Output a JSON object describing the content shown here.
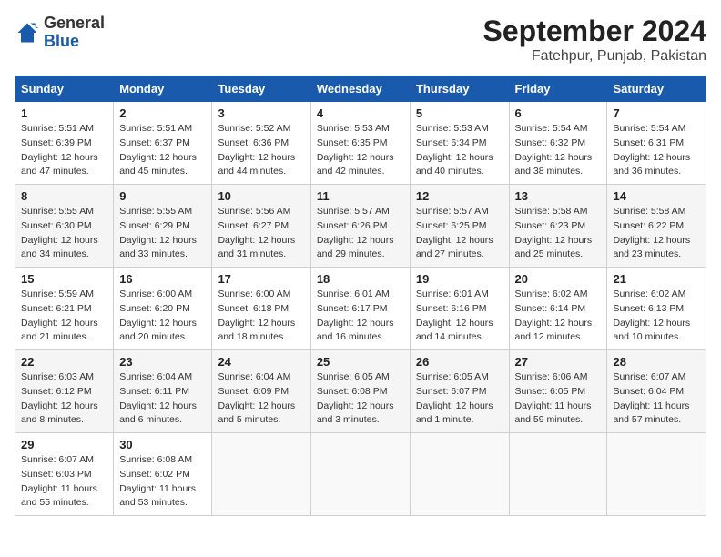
{
  "header": {
    "logo_general": "General",
    "logo_blue": "Blue",
    "month_year": "September 2024",
    "location": "Fatehpur, Punjab, Pakistan"
  },
  "weekdays": [
    "Sunday",
    "Monday",
    "Tuesday",
    "Wednesday",
    "Thursday",
    "Friday",
    "Saturday"
  ],
  "weeks": [
    [
      {
        "day": "1",
        "sunrise": "5:51 AM",
        "sunset": "6:39 PM",
        "daylight": "12 hours and 47 minutes."
      },
      {
        "day": "2",
        "sunrise": "5:51 AM",
        "sunset": "6:37 PM",
        "daylight": "12 hours and 45 minutes."
      },
      {
        "day": "3",
        "sunrise": "5:52 AM",
        "sunset": "6:36 PM",
        "daylight": "12 hours and 44 minutes."
      },
      {
        "day": "4",
        "sunrise": "5:53 AM",
        "sunset": "6:35 PM",
        "daylight": "12 hours and 42 minutes."
      },
      {
        "day": "5",
        "sunrise": "5:53 AM",
        "sunset": "6:34 PM",
        "daylight": "12 hours and 40 minutes."
      },
      {
        "day": "6",
        "sunrise": "5:54 AM",
        "sunset": "6:32 PM",
        "daylight": "12 hours and 38 minutes."
      },
      {
        "day": "7",
        "sunrise": "5:54 AM",
        "sunset": "6:31 PM",
        "daylight": "12 hours and 36 minutes."
      }
    ],
    [
      {
        "day": "8",
        "sunrise": "5:55 AM",
        "sunset": "6:30 PM",
        "daylight": "12 hours and 34 minutes."
      },
      {
        "day": "9",
        "sunrise": "5:55 AM",
        "sunset": "6:29 PM",
        "daylight": "12 hours and 33 minutes."
      },
      {
        "day": "10",
        "sunrise": "5:56 AM",
        "sunset": "6:27 PM",
        "daylight": "12 hours and 31 minutes."
      },
      {
        "day": "11",
        "sunrise": "5:57 AM",
        "sunset": "6:26 PM",
        "daylight": "12 hours and 29 minutes."
      },
      {
        "day": "12",
        "sunrise": "5:57 AM",
        "sunset": "6:25 PM",
        "daylight": "12 hours and 27 minutes."
      },
      {
        "day": "13",
        "sunrise": "5:58 AM",
        "sunset": "6:23 PM",
        "daylight": "12 hours and 25 minutes."
      },
      {
        "day": "14",
        "sunrise": "5:58 AM",
        "sunset": "6:22 PM",
        "daylight": "12 hours and 23 minutes."
      }
    ],
    [
      {
        "day": "15",
        "sunrise": "5:59 AM",
        "sunset": "6:21 PM",
        "daylight": "12 hours and 21 minutes."
      },
      {
        "day": "16",
        "sunrise": "6:00 AM",
        "sunset": "6:20 PM",
        "daylight": "12 hours and 20 minutes."
      },
      {
        "day": "17",
        "sunrise": "6:00 AM",
        "sunset": "6:18 PM",
        "daylight": "12 hours and 18 minutes."
      },
      {
        "day": "18",
        "sunrise": "6:01 AM",
        "sunset": "6:17 PM",
        "daylight": "12 hours and 16 minutes."
      },
      {
        "day": "19",
        "sunrise": "6:01 AM",
        "sunset": "6:16 PM",
        "daylight": "12 hours and 14 minutes."
      },
      {
        "day": "20",
        "sunrise": "6:02 AM",
        "sunset": "6:14 PM",
        "daylight": "12 hours and 12 minutes."
      },
      {
        "day": "21",
        "sunrise": "6:02 AM",
        "sunset": "6:13 PM",
        "daylight": "12 hours and 10 minutes."
      }
    ],
    [
      {
        "day": "22",
        "sunrise": "6:03 AM",
        "sunset": "6:12 PM",
        "daylight": "12 hours and 8 minutes."
      },
      {
        "day": "23",
        "sunrise": "6:04 AM",
        "sunset": "6:11 PM",
        "daylight": "12 hours and 6 minutes."
      },
      {
        "day": "24",
        "sunrise": "6:04 AM",
        "sunset": "6:09 PM",
        "daylight": "12 hours and 5 minutes."
      },
      {
        "day": "25",
        "sunrise": "6:05 AM",
        "sunset": "6:08 PM",
        "daylight": "12 hours and 3 minutes."
      },
      {
        "day": "26",
        "sunrise": "6:05 AM",
        "sunset": "6:07 PM",
        "daylight": "12 hours and 1 minute."
      },
      {
        "day": "27",
        "sunrise": "6:06 AM",
        "sunset": "6:05 PM",
        "daylight": "11 hours and 59 minutes."
      },
      {
        "day": "28",
        "sunrise": "6:07 AM",
        "sunset": "6:04 PM",
        "daylight": "11 hours and 57 minutes."
      }
    ],
    [
      {
        "day": "29",
        "sunrise": "6:07 AM",
        "sunset": "6:03 PM",
        "daylight": "11 hours and 55 minutes."
      },
      {
        "day": "30",
        "sunrise": "6:08 AM",
        "sunset": "6:02 PM",
        "daylight": "11 hours and 53 minutes."
      },
      null,
      null,
      null,
      null,
      null
    ]
  ]
}
